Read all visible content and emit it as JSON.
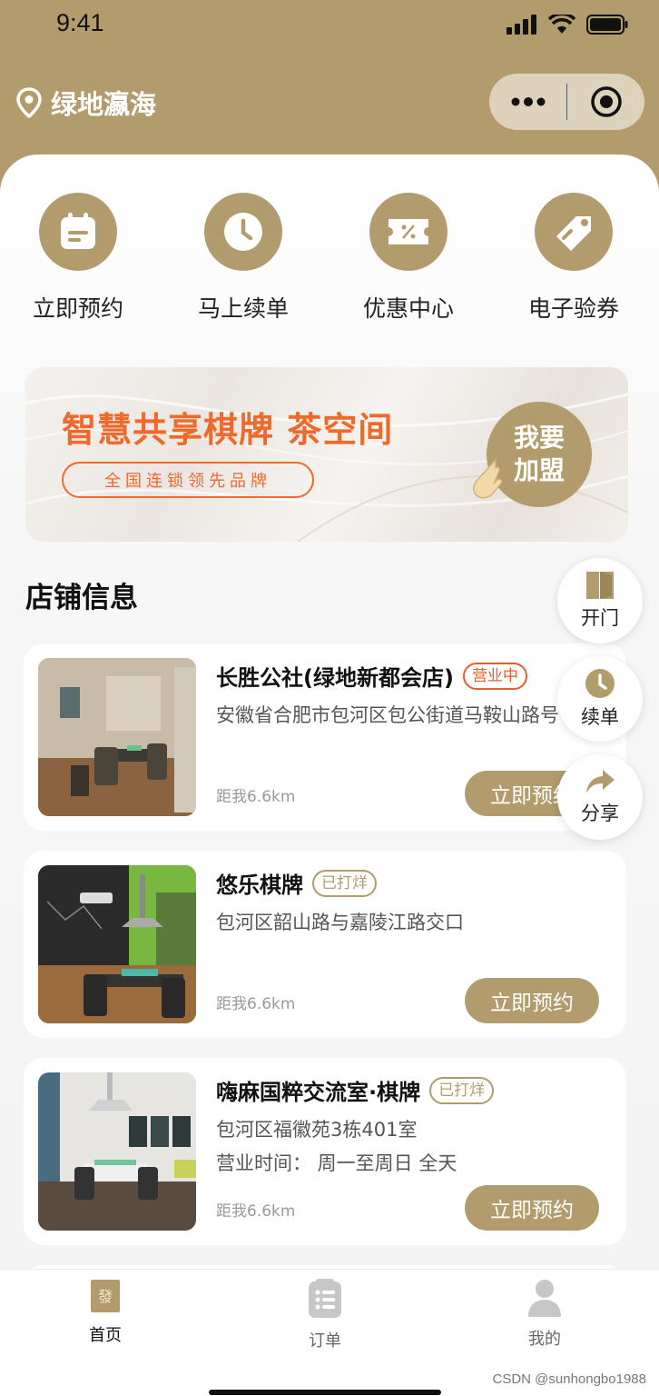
{
  "status_bar": {
    "time": "9:41"
  },
  "header": {
    "location": "绿地瀛海"
  },
  "quick_actions": [
    {
      "label": "立即预约",
      "icon": "calendar-icon"
    },
    {
      "label": "马上续单",
      "icon": "clock-icon"
    },
    {
      "label": "优惠中心",
      "icon": "ticket-icon"
    },
    {
      "label": "电子验券",
      "icon": "tag-icon"
    }
  ],
  "banner": {
    "title": "智慧共享棋牌 茶空间",
    "subtitle": "全国连锁领先品牌",
    "join_label": "我要加盟"
  },
  "section": {
    "title": "店铺信息"
  },
  "stores": [
    {
      "name": "长胜公社(绿地新都会店)",
      "status": "营业中",
      "address": "安徽省合肥市包河区包公街道马鞍山路号",
      "hours": "",
      "distance": "距我6.6km",
      "button": "立即预约"
    },
    {
      "name": "悠乐棋牌",
      "status": "已打烊",
      "address": "包河区韶山路与嘉陵江路交口",
      "hours": "",
      "distance": "距我6.6km",
      "button": "立即预约"
    },
    {
      "name": "嗨麻国粹交流室·棋牌",
      "status": "已打烊",
      "address": "包河区福徽苑3栋401室",
      "hours": "营业时间：  周一至周日 全天",
      "distance": "距我6.6km",
      "button": "立即预约"
    }
  ],
  "float_actions": [
    {
      "label": "开门",
      "icon": "door-icon"
    },
    {
      "label": "续单",
      "icon": "clock-icon"
    },
    {
      "label": "分享",
      "icon": "share-icon"
    }
  ],
  "tabbar": {
    "items": [
      {
        "label": "首页",
        "icon": "home-logo-icon",
        "active": true
      },
      {
        "label": "订单",
        "icon": "order-list-icon",
        "active": false
      },
      {
        "label": "我的",
        "icon": "user-icon",
        "active": false
      }
    ]
  },
  "watermark": "CSDN @sunhongbo1988",
  "colors": {
    "brand": "#b29b6c",
    "accent": "#ef6a2a",
    "open": "#e85d2c"
  }
}
